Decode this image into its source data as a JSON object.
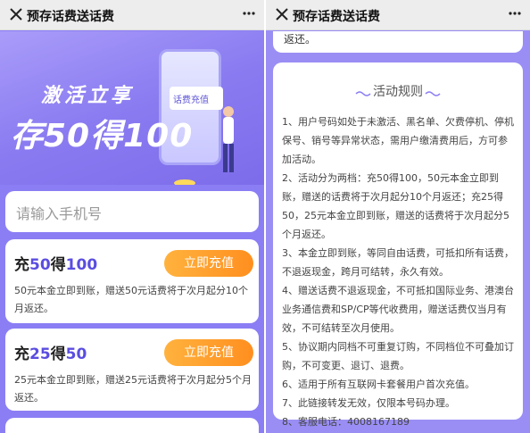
{
  "window": {
    "title": "预存话费送话费"
  },
  "left": {
    "hero": {
      "line1": "激活立享",
      "line2": "存50得100",
      "phone_card": "话费充值"
    },
    "phone_input": {
      "placeholder": "请输入手机号"
    },
    "offers": [
      {
        "prefix": "充",
        "amount": "50",
        "mid": "得",
        "get": "100",
        "button": "立即充值",
        "desc": "50元本金立即到账，赠送50元话费将于次月起分10个月返还。"
      },
      {
        "prefix": "充",
        "amount": "25",
        "mid": "得",
        "get": "50",
        "button": "立即充值",
        "desc": "25元本金立即到账，赠送25元话费将于次月起分5个月返还。"
      }
    ]
  },
  "right": {
    "top_card_text": "返还。",
    "rules_title": "活动规则",
    "rules": [
      "1、用户号码如处于未激活、黑名单、欠费停机、停机保号、销号等异常状态，需用户缴清费用后，方可参加活动。",
      "2、活动分为两档：充50得100，50元本金立即到账，赠送的话费将于次月起分10个月返还；充25得50，25元本金立即到账，赠送的话费将于次月起分5个月返还。",
      "3、本金立即到账，等同自由话费，可抵扣所有话费，不退返现金，跨月可结转，永久有效。",
      "4、赠送话费不退返现金，不可抵扣国际业务、港澳台业务通信费和SP/CP等代收费用，赠送话费仅当月有效，不可结转至次月使用。",
      "5、协议期内同档不可重复订购，不同档位不可叠加订购，不可变更、退订、退费。",
      "6、适用于所有互联网卡套餐用户首次充值。",
      "7、此链接转发无效，仅限本号码办理。",
      "8、客服电话：4008167189"
    ]
  },
  "colors": {
    "purple_bg": "#8b7ef4",
    "accent_purple": "#5a4de0",
    "button_orange": "#ff9a2a"
  },
  "icons": [
    "close-icon",
    "more-icon"
  ]
}
